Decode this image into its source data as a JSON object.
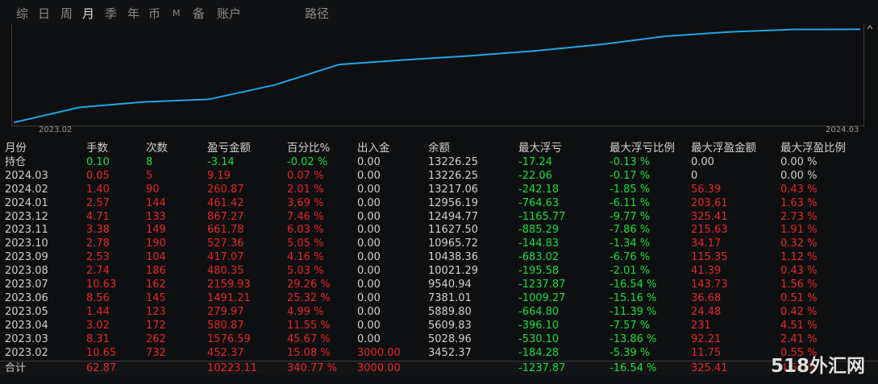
{
  "tabs": [
    {
      "label": "综",
      "key": "summary"
    },
    {
      "label": "日",
      "key": "day"
    },
    {
      "label": "周",
      "key": "week"
    },
    {
      "label": "月",
      "key": "month",
      "active": true
    },
    {
      "label": "季",
      "key": "quarter"
    },
    {
      "label": "年",
      "key": "year"
    },
    {
      "label": "币",
      "key": "currency"
    },
    {
      "label": "M",
      "key": "m"
    },
    {
      "label": "备",
      "key": "backup"
    },
    {
      "label": "账户",
      "key": "account"
    },
    {
      "label": "路径",
      "key": "path"
    }
  ],
  "chart_data": {
    "type": "line",
    "x": [
      "2023.02",
      "2023.03",
      "2023.04",
      "2023.05",
      "2023.06",
      "2023.07",
      "2023.08",
      "2023.09",
      "2023.10",
      "2023.11",
      "2023.12",
      "2024.01",
      "2024.02",
      "2024.03"
    ],
    "series": [
      {
        "values": [
          3452.37,
          5028.96,
          5609.83,
          5889.8,
          7381.01,
          9540.94,
          10021.29,
          10438.36,
          10965.72,
          11627.5,
          12494.77,
          12956.19,
          13217.06,
          13226.25
        ]
      }
    ],
    "xtick_labels": [
      "2023.02",
      "2024.03"
    ],
    "line_color": "#1fa6e8"
  },
  "table": {
    "headers": [
      "月份",
      "手数",
      "次数",
      "盈亏金额",
      "百分比%",
      "出入金",
      "余额",
      "最大浮亏",
      "最大浮亏比例",
      "最大浮盈金额",
      "最大浮盈比例"
    ],
    "hold_row": {
      "month": "持仓",
      "lots": "0.10",
      "count": "8",
      "pnl": "-3.14",
      "pct": "-0.02 %",
      "flow": "0.00",
      "balance": "13226.25",
      "max_loss": "-17.24",
      "max_loss_pct": "-0.13 %",
      "max_gain": "0.00",
      "max_gain_pct": "0.00 %"
    },
    "rows": [
      {
        "month": "2024.03",
        "lots": "0.05",
        "count": "5",
        "pnl": "9.19",
        "pct": "0.07 %",
        "flow": "0.00",
        "balance": "13226.25",
        "max_loss": "-22.06",
        "max_loss_pct": "-0.17 %",
        "max_gain": "0",
        "max_gain_pct": "0.00 %",
        "gain_white": true
      },
      {
        "month": "2024.02",
        "lots": "1.40",
        "count": "90",
        "pnl": "260.87",
        "pct": "2.01 %",
        "flow": "0.00",
        "balance": "13217.06",
        "max_loss": "-242.18",
        "max_loss_pct": "-1.85 %",
        "max_gain": "56.39",
        "max_gain_pct": "0.43 %"
      },
      {
        "month": "2024.01",
        "lots": "2.57",
        "count": "144",
        "pnl": "461.42",
        "pct": "3.69 %",
        "flow": "0.00",
        "balance": "12956.19",
        "max_loss": "-764.63",
        "max_loss_pct": "-6.11 %",
        "max_gain": "203.61",
        "max_gain_pct": "1.63 %"
      },
      {
        "month": "2023.12",
        "lots": "4.71",
        "count": "133",
        "pnl": "867.27",
        "pct": "7.46 %",
        "flow": "0.00",
        "balance": "12494.77",
        "max_loss": "-1165.77",
        "max_loss_pct": "-9.77 %",
        "max_gain": "325.41",
        "max_gain_pct": "2.73 %"
      },
      {
        "month": "2023.11",
        "lots": "3.38",
        "count": "149",
        "pnl": "661.78",
        "pct": "6.03 %",
        "flow": "0.00",
        "balance": "11627.50",
        "max_loss": "-885.29",
        "max_loss_pct": "-7.86 %",
        "max_gain": "215.63",
        "max_gain_pct": "1.91 %"
      },
      {
        "month": "2023.10",
        "lots": "2.78",
        "count": "190",
        "pnl": "527.36",
        "pct": "5.05 %",
        "flow": "0.00",
        "balance": "10965.72",
        "max_loss": "-144.83",
        "max_loss_pct": "-1.34 %",
        "max_gain": "34.17",
        "max_gain_pct": "0.32 %"
      },
      {
        "month": "2023.09",
        "lots": "2.53",
        "count": "104",
        "pnl": "417.07",
        "pct": "4.16 %",
        "flow": "0.00",
        "balance": "10438.36",
        "max_loss": "-683.02",
        "max_loss_pct": "-6.76 %",
        "max_gain": "115.35",
        "max_gain_pct": "1.12 %"
      },
      {
        "month": "2023.08",
        "lots": "2.74",
        "count": "186",
        "pnl": "480.35",
        "pct": "5.03 %",
        "flow": "0.00",
        "balance": "10021.29",
        "max_loss": "-195.58",
        "max_loss_pct": "-2.01 %",
        "max_gain": "41.39",
        "max_gain_pct": "0.43 %"
      },
      {
        "month": "2023.07",
        "lots": "10.63",
        "count": "162",
        "pnl": "2159.93",
        "pct": "29.26 %",
        "flow": "0.00",
        "balance": "9540.94",
        "max_loss": "-1237.87",
        "max_loss_pct": "-16.54 %",
        "max_gain": "143.73",
        "max_gain_pct": "1.56 %"
      },
      {
        "month": "2023.06",
        "lots": "8.56",
        "count": "145",
        "pnl": "1491.21",
        "pct": "25.32 %",
        "flow": "0.00",
        "balance": "7381.01",
        "max_loss": "-1009.27",
        "max_loss_pct": "-15.16 %",
        "max_gain": "36.68",
        "max_gain_pct": "0.51 %"
      },
      {
        "month": "2023.05",
        "lots": "1.44",
        "count": "123",
        "pnl": "279.97",
        "pct": "4.99 %",
        "flow": "0.00",
        "balance": "5889.80",
        "max_loss": "-664.80",
        "max_loss_pct": "-11.39 %",
        "max_gain": "24.48",
        "max_gain_pct": "0.42 %"
      },
      {
        "month": "2023.04",
        "lots": "3.02",
        "count": "172",
        "pnl": "580.87",
        "pct": "11.55 %",
        "flow": "0.00",
        "balance": "5609.83",
        "max_loss": "-396.10",
        "max_loss_pct": "-7.57 %",
        "max_gain": "231",
        "max_gain_pct": "4.51 %"
      },
      {
        "month": "2023.03",
        "lots": "8.31",
        "count": "262",
        "pnl": "1576.59",
        "pct": "45.67 %",
        "flow": "0.00",
        "balance": "5028.96",
        "max_loss": "-530.10",
        "max_loss_pct": "-13.86 %",
        "max_gain": "92.21",
        "max_gain_pct": "2.41 %"
      },
      {
        "month": "2023.02",
        "lots": "10.65",
        "count": "732",
        "pnl": "452.37",
        "pct": "15.08 %",
        "flow": "3000.00",
        "balance": "3452.37",
        "max_loss": "-184.28",
        "max_loss_pct": "-5.39 %",
        "max_gain": "11.75",
        "max_gain_pct": "0.55 %",
        "flow_red": true
      }
    ],
    "total_row": {
      "month": "合计",
      "lots": "62.87",
      "count": "",
      "pnl": "10223.11",
      "pct": "340.77 %",
      "flow": "3000.00",
      "balance": "",
      "max_loss": "-1237.87",
      "max_loss_pct": "-16.54 %",
      "max_gain": "325.41",
      "max_gain_pct": "4.51 %"
    }
  },
  "watermark": "518外汇网",
  "colors": {
    "red": "#e8262b",
    "green": "#17e03c",
    "line": "#1fa6e8",
    "bg": "#0e0f10"
  }
}
